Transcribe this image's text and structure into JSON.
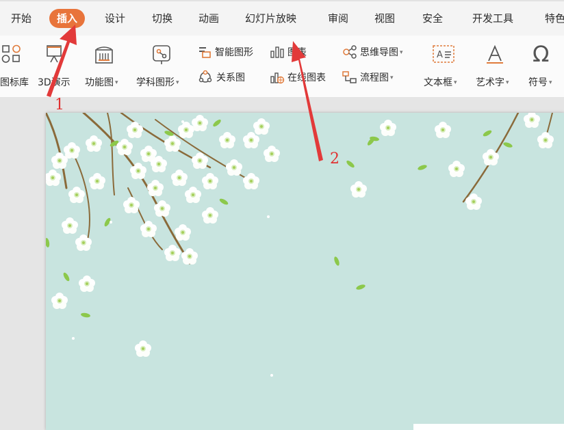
{
  "tabs": [
    {
      "label": "开始",
      "active": false
    },
    {
      "label": "插入",
      "active": true
    },
    {
      "label": "设计",
      "active": false
    },
    {
      "label": "切换",
      "active": false
    },
    {
      "label": "动画",
      "active": false
    },
    {
      "label": "幻灯片放映",
      "active": false
    },
    {
      "label": "审阅",
      "active": false
    },
    {
      "label": "视图",
      "active": false
    },
    {
      "label": "安全",
      "active": false
    },
    {
      "label": "开发工具",
      "active": false
    },
    {
      "label": "特色"
    }
  ],
  "ribbon": {
    "icon_library": {
      "label": "图标库",
      "icon": "icon-library-icon"
    },
    "demo3d": {
      "label": "3D演示",
      "icon": "3d-presentation-icon"
    },
    "function_chart": {
      "label": "功能图",
      "icon": "function-chart-icon"
    },
    "subject_shapes": {
      "label": "学科图形",
      "icon": "subject-shapes-icon"
    },
    "smart_shapes": {
      "label": "智能图形",
      "icon": "smart-shapes-icon"
    },
    "chart": {
      "label": "图表",
      "icon": "chart-icon"
    },
    "relation_chart": {
      "label": "关系图",
      "icon": "relation-chart-icon"
    },
    "online_chart": {
      "label": "在线图表",
      "icon": "online-chart-icon"
    },
    "mind_map": {
      "label": "思维导图",
      "icon": "mind-map-icon"
    },
    "flowchart": {
      "label": "流程图",
      "icon": "flowchart-icon"
    },
    "textbox": {
      "label": "文本框",
      "icon": "textbox-icon"
    },
    "art_text": {
      "label": "艺术字",
      "icon": "art-text-icon"
    },
    "symbol": {
      "label": "符号",
      "icon": "omega-icon"
    }
  },
  "annotations": {
    "one": "1",
    "two": "2"
  },
  "colors": {
    "accent": "#e8743b",
    "slide_bg": "#c8e4df",
    "arrow": "#e23a3a",
    "branch": "#8a6a3a",
    "leaf": "#8cc84b"
  }
}
